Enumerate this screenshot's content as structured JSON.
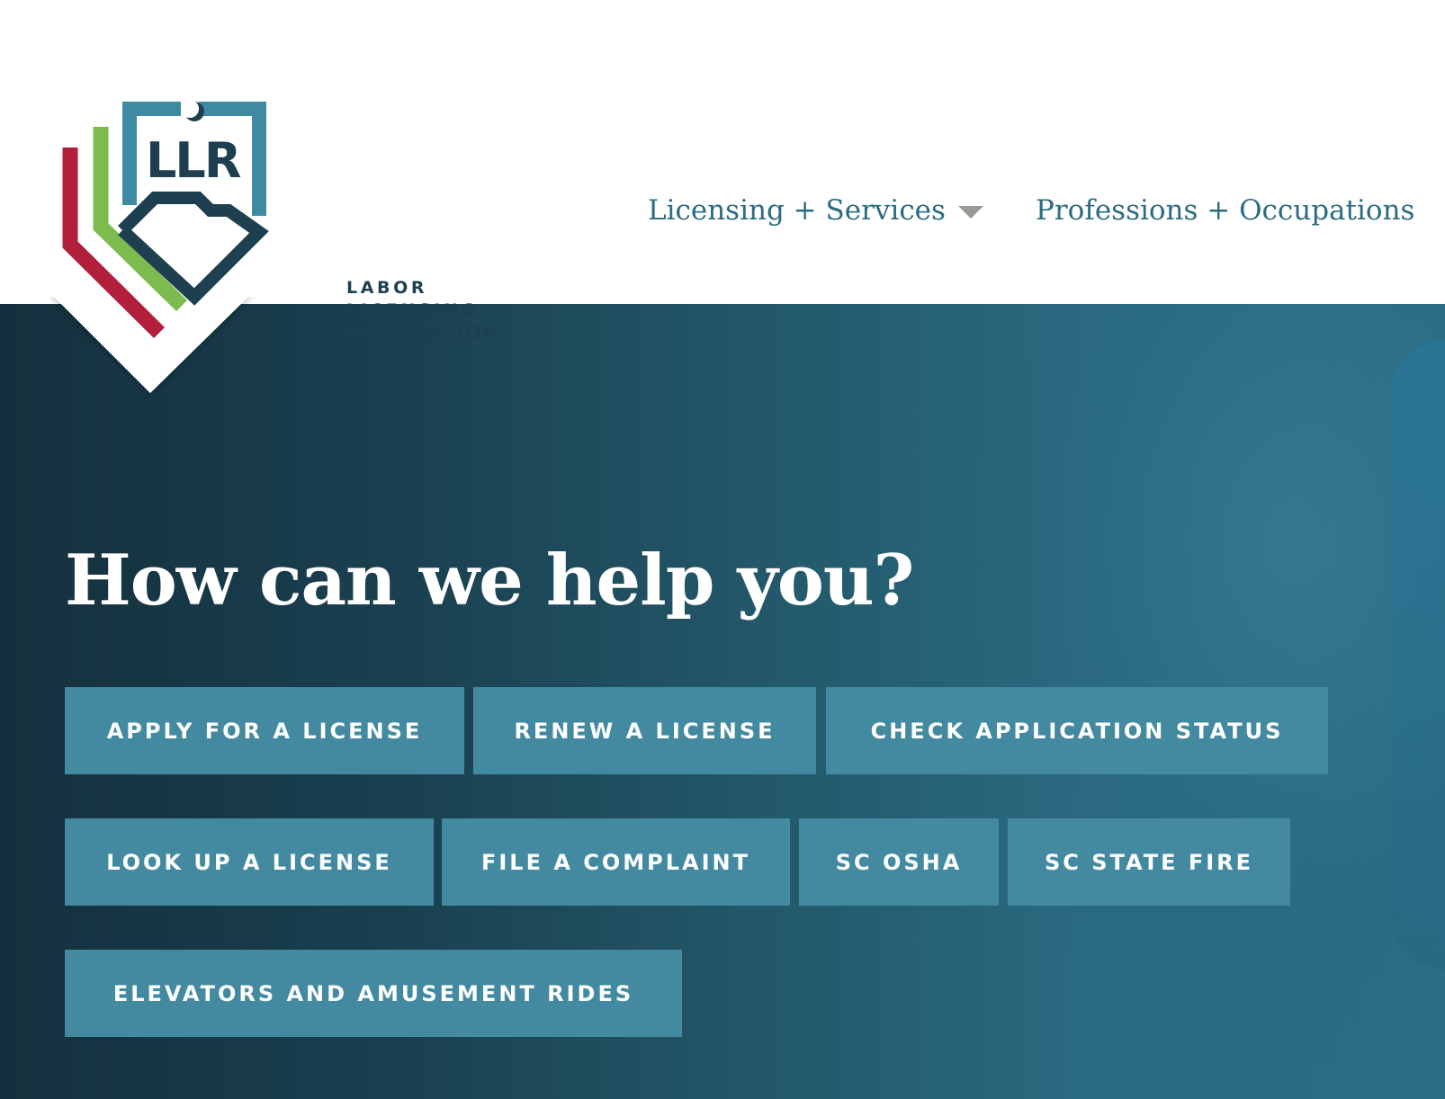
{
  "brand": {
    "logo_mark": "LLR",
    "logo_lines": [
      "LABOR",
      "LICENSING",
      "REGULATION"
    ],
    "colors": {
      "red": "#b11f3b",
      "green": "#7dbb4e",
      "teal": "#3f8aa3",
      "navy": "#1e3f4f"
    }
  },
  "nav": {
    "licensing_label": "Licensing + Services",
    "professions_label": "Professions + Occupations",
    "dropdown_icon": "caret-down-icon"
  },
  "hero": {
    "title": "How can we help you?",
    "buttons": [
      "APPLY FOR A LICENSE",
      "RENEW A LICENSE",
      "CHECK APPLICATION STATUS",
      "LOOK UP A LICENSE",
      "FILE A COMPLAINT",
      "SC OSHA",
      "SC STATE FIRE",
      "ELEVATORS AND AMUSEMENT RIDES"
    ]
  },
  "colors": {
    "nav_text": "#2b6c80",
    "button_bg": "#438aa1",
    "hero_dark": "#14303d",
    "hero_light": "#2b6e85"
  }
}
